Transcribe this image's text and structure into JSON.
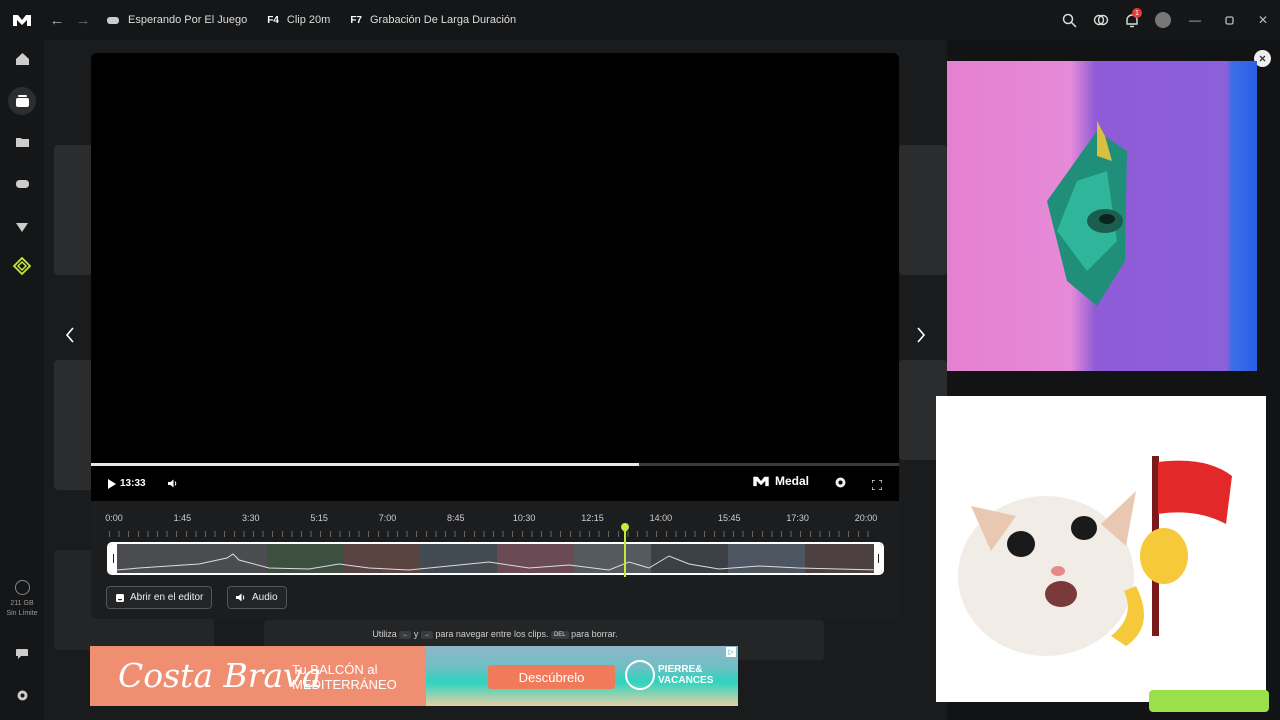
{
  "titlebar": {
    "crumbs": [
      {
        "key": "",
        "label": "Esperando Por El Juego",
        "icon": "gamepad-icon"
      },
      {
        "key": "F4",
        "label": "Clip 20m"
      },
      {
        "key": "F7",
        "label": "Grabación De Larga Duración"
      }
    ],
    "notification_count": "1"
  },
  "sidebar": {
    "items": [
      "home-icon",
      "clips-icon",
      "folder-icon",
      "gamepad-icon",
      "gift-icon",
      "premium-icon"
    ],
    "storage_size": "211 GB",
    "storage_label": "Sin Límite"
  },
  "player": {
    "time": "13:33",
    "brand": "Medal",
    "progress": 0.678,
    "timeline_labels": [
      "0:00",
      "1:45",
      "3:30",
      "5:15",
      "7:00",
      "8:45",
      "10:30",
      "12:15",
      "14:00",
      "15:45",
      "17:30",
      "20:00"
    ],
    "playhead_fraction": 0.678,
    "open_editor_label": "Abrir en el editor",
    "audio_label": "Audio"
  },
  "hint": {
    "prefix": "Utiliza",
    "key_left": "←",
    "and": "y",
    "key_right": "→",
    "nav_text": "para navegar entre los clips.",
    "key_del": "DEL",
    "delete_text": "para borrar."
  },
  "ad": {
    "brand": "Costa Brava",
    "tagline_1": "Tu BALCÓN al",
    "tagline_2": "MEDITERRÁNEO",
    "cta": "Descúbrelo",
    "partner_1": "PIERRE&",
    "partner_2": "VACANCES"
  },
  "colors": {
    "accent": "#c4ea3c",
    "ad_coral": "#f08e72"
  }
}
